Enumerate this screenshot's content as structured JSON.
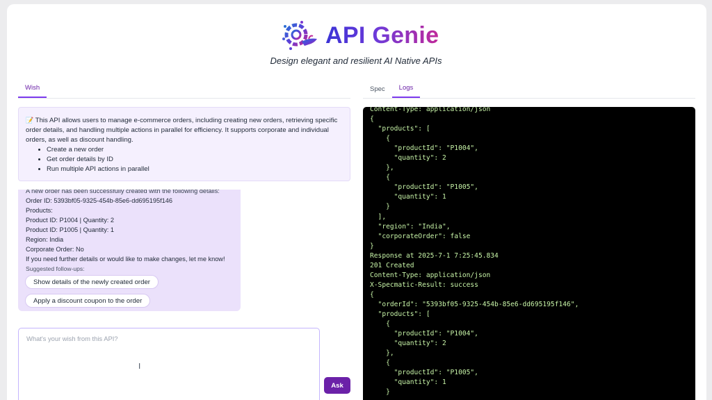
{
  "header": {
    "app_name": "API Genie",
    "tagline": "Design elegant and resilient AI Native APIs",
    "logo_icon": "gear-lamp-icon"
  },
  "left_tabs": [
    {
      "label": "Wish",
      "active": true
    }
  ],
  "right_tabs": [
    {
      "label": "Spec",
      "active": false
    },
    {
      "label": "Logs",
      "active": true
    }
  ],
  "info": {
    "emoji": "📝",
    "description": "This API allows users to manage e-commerce orders, including creating new orders, retrieving specific order details, and handling multiple actions in parallel for efficiency. It supports corporate and individual orders, as well as discount handling.",
    "bullets": [
      "Create a new order",
      "Get order details by ID",
      "Run multiple API actions in parallel"
    ]
  },
  "chat": {
    "lines": [
      "A new order has been successfully created with the following details:",
      "Order ID: 5393bf05-9325-454b-85e6-dd695195f146",
      "Products:",
      "Product ID: P1004 | Quantity: 2",
      "Product ID: P1005 | Quantity: 1",
      "Region: India",
      "Corporate Order: No",
      "If you need further details or would like to make changes, let me know!"
    ],
    "followups_label": "Suggested follow-ups:",
    "followups": [
      "Show details of the newly created order",
      "Apply a discount coupon to the order"
    ]
  },
  "input": {
    "placeholder": "What's your wish from this API?",
    "value": "",
    "ask_label": "Ask"
  },
  "logs": [
    "Content-Type: application/json",
    "{",
    "  \"products\": [",
    "    {",
    "      \"productId\": \"P1004\",",
    "      \"quantity\": 2",
    "    },",
    "    {",
    "      \"productId\": \"P1005\",",
    "      \"quantity\": 1",
    "    }",
    "  ],",
    "  \"region\": \"India\",",
    "  \"corporateOrder\": false",
    "}",
    "Response at 2025-7-1 7:25:45.834",
    "201 Created",
    "Content-Type: application/json",
    "X-Specmatic-Result: success",
    "{",
    "  \"orderId\": \"5393bf05-9325-454b-85e6-dd695195f146\",",
    "  \"products\": [",
    "    {",
    "      \"productId\": \"P1004\",",
    "      \"quantity\": 2",
    "    },",
    "    {",
    "      \"productId\": \"P1005\",",
    "      \"quantity\": 1",
    "    }",
    "  ],"
  ],
  "colors": {
    "accent": "#6b21a8",
    "terminal_bg": "#000000",
    "terminal_text": "#c8f5a8",
    "info_bg": "#f5f0fe",
    "bubble_bg": "#ebe1fb"
  }
}
